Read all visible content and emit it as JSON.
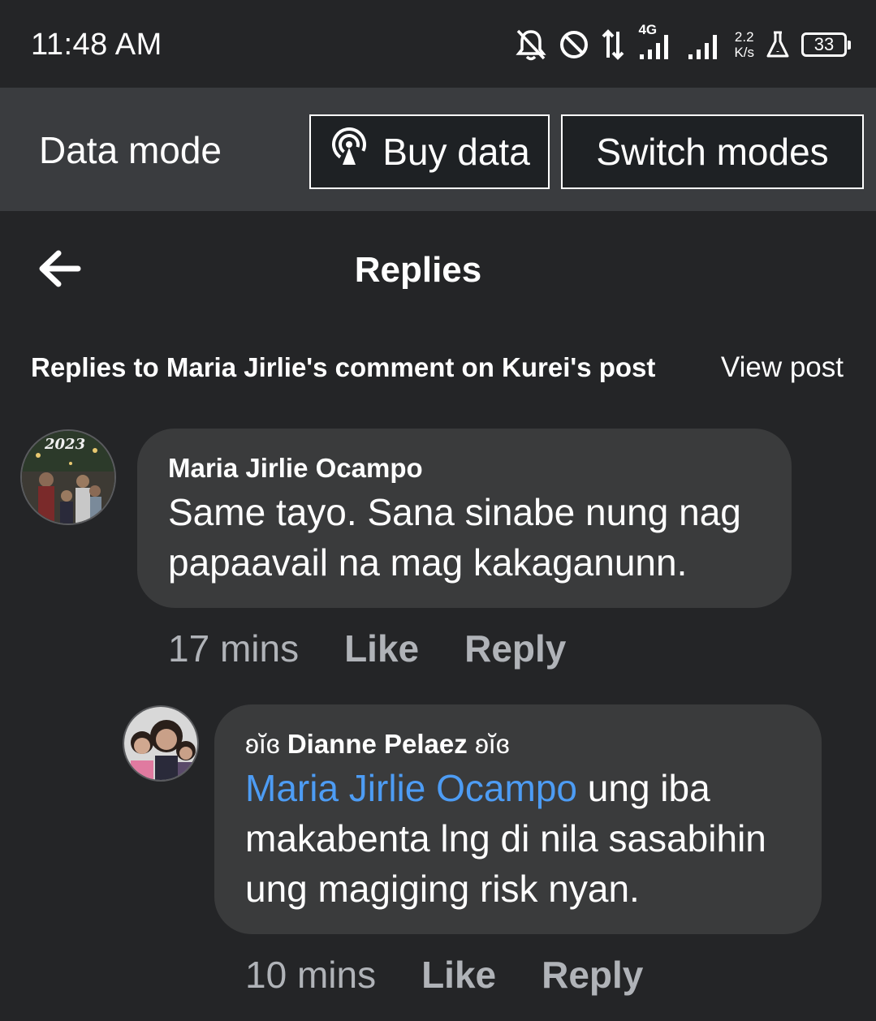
{
  "status_bar": {
    "time": "11:48 AM",
    "network_type": "4G",
    "speed_value": "2.2",
    "speed_unit": "K/s",
    "battery_level": "33",
    "icons": [
      "bell-off-icon",
      "do-not-disturb-icon",
      "data-transfer-icon",
      "signal-4g-icon",
      "signal-icon",
      "flask-icon",
      "battery-icon"
    ]
  },
  "data_bar": {
    "label": "Data mode",
    "buy_data_label": "Buy data",
    "switch_modes_label": "Switch modes"
  },
  "header": {
    "title": "Replies"
  },
  "context": {
    "description": "Replies to Maria Jirlie's comment on Kurei's post",
    "view_post_label": "View post"
  },
  "comments": [
    {
      "author": "Maria Jirlie Ocampo",
      "avatar_text": "2023",
      "text": "Same tayo.  Sana sinabe nung nag papaavail na mag kakaganunn.",
      "time": "17 mins",
      "like_label": "Like",
      "reply_label": "Reply"
    },
    {
      "author_prefix": "ʚĭɞ",
      "author": "Dianne Pelaez",
      "author_suffix": "ʚĭɞ",
      "mention": "Maria Jirlie Ocampo",
      "text": " ung iba makabenta lng di nila sasabihin ung magiging risk nyan.",
      "time": "10 mins",
      "like_label": "Like",
      "reply_label": "Reply"
    }
  ],
  "colors": {
    "background": "#242527",
    "data_bar": "#3a3c3f",
    "bubble": "#3a3b3c",
    "mention": "#4d9cf4",
    "meta_text": "#b0b3b8"
  }
}
